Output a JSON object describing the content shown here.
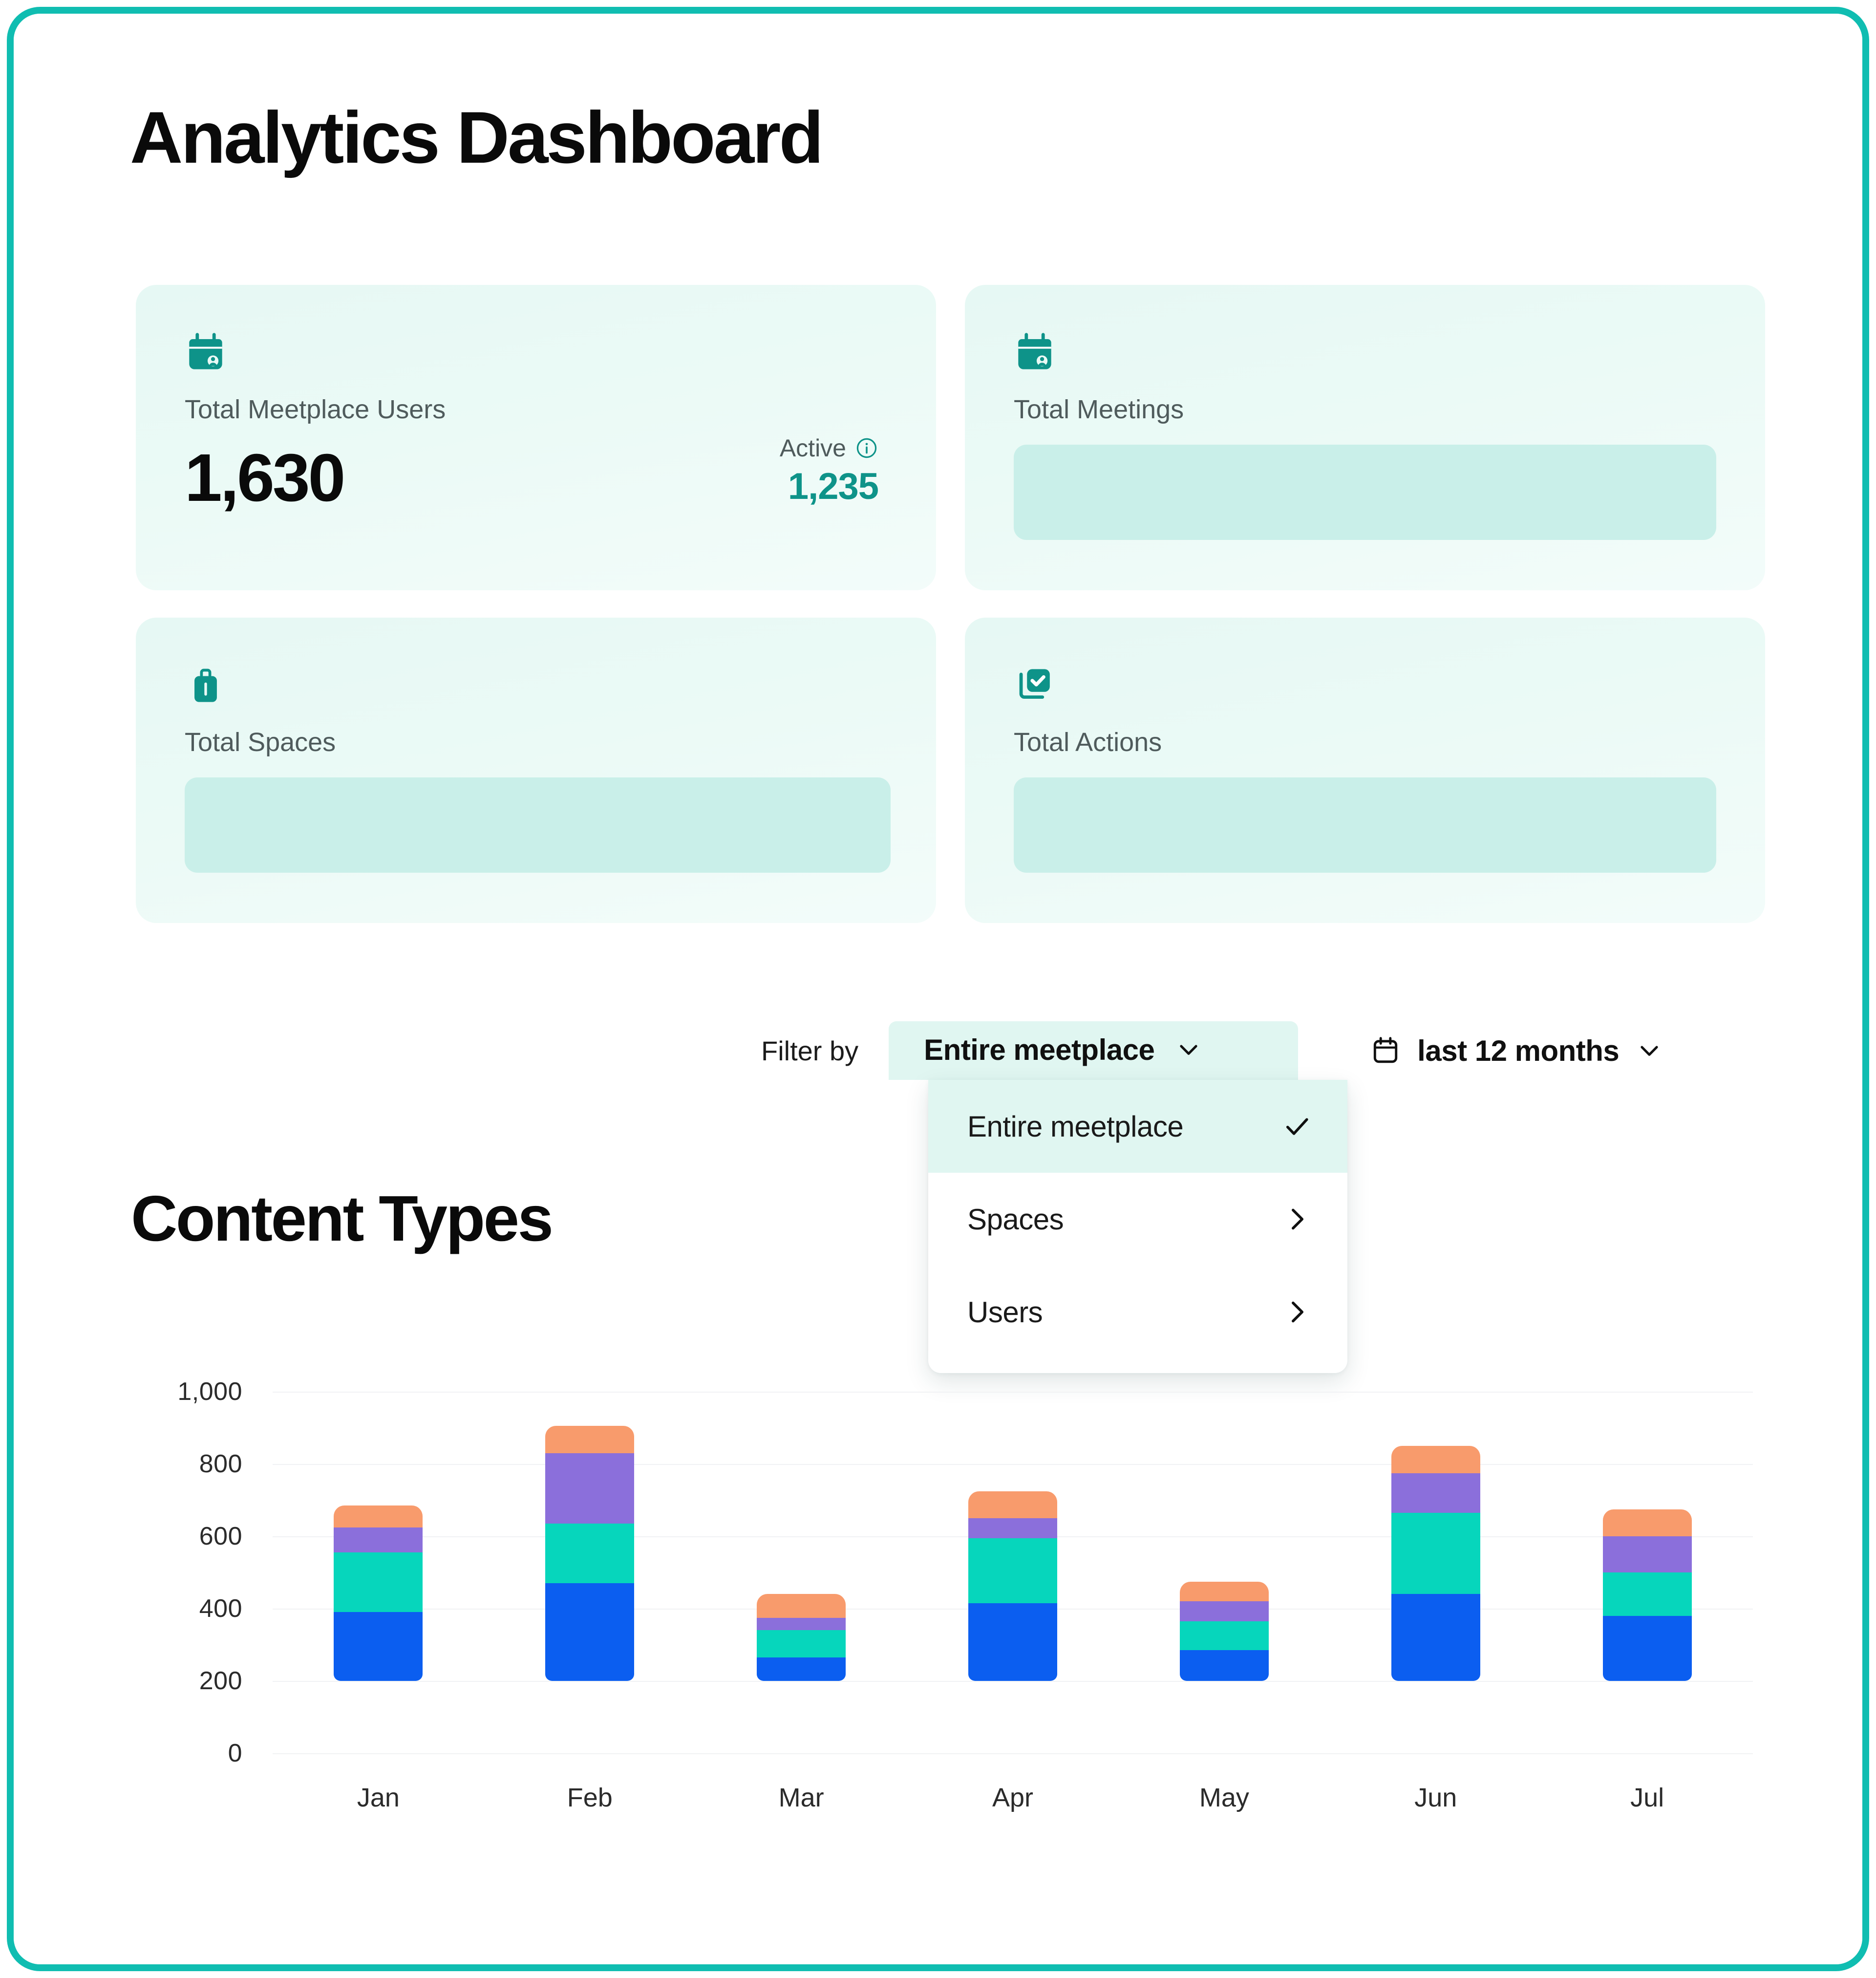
{
  "page": {
    "title": "Analytics Dashboard",
    "frame_color": "#10BDB1"
  },
  "kpis": [
    {
      "icon": "calendar-user-icon",
      "label": "Total Meetplace Users",
      "value": "1,630",
      "sub_label": "Active",
      "sub_info_icon": "info-icon",
      "sub_value": "1,235",
      "loading": false
    },
    {
      "icon": "calendar-user-icon",
      "label": "Total Meetings",
      "value": "",
      "loading": true
    },
    {
      "icon": "briefcase-icon",
      "label": "Total Spaces",
      "value": "",
      "loading": true
    },
    {
      "icon": "checked-documents-icon",
      "label": "Total Actions",
      "value": "",
      "loading": true
    }
  ],
  "filter": {
    "label": "Filter by",
    "scope": {
      "selected": "Entire meetplace",
      "chevron_icon": "chevron-down-icon",
      "open": true,
      "options": [
        {
          "label": "Entire meetplace",
          "selected": true,
          "trailing_icon": "check-icon"
        },
        {
          "label": "Spaces",
          "selected": false,
          "trailing_icon": "chevron-right-icon"
        },
        {
          "label": "Users",
          "selected": false,
          "trailing_icon": "chevron-right-icon"
        }
      ]
    },
    "range": {
      "calendar_icon": "calendar-icon",
      "selected": "last 12 months",
      "chevron_icon": "chevron-down-icon"
    }
  },
  "section": {
    "title": "Content Types"
  },
  "colors": {
    "accent_teal": "#0E9389",
    "frame_teal": "#10BDB1",
    "card_bg": "#E9F9F5",
    "skeleton": "#C9EFE9",
    "menu_selected_bg": "#E0F6F1",
    "series_blue": "#0B5EF0",
    "series_teal": "#06D6BC",
    "series_purple": "#8B6FDB",
    "series_orange": "#F89B6C"
  },
  "chart_data": {
    "type": "bar",
    "stacked": true,
    "title": "Content Types",
    "xlabel": "",
    "ylabel": "",
    "ylim": [
      0,
      1000
    ],
    "yticks": [
      0,
      200,
      400,
      600,
      800,
      1000
    ],
    "ytick_labels": [
      "0",
      "200",
      "400",
      "600",
      "800",
      "1,000"
    ],
    "grid": true,
    "legend": "none",
    "note": "Bars are clipped at the 200 gridline in the source rendering; segment values are cumulative totals read off the axis.",
    "categories": [
      "Jan",
      "Feb",
      "Mar",
      "Apr",
      "May",
      "Jun",
      "Jul"
    ],
    "series": [
      {
        "name": "series-1",
        "color": "#0B5EF0",
        "values": [
          390,
          470,
          265,
          415,
          285,
          440,
          380
        ]
      },
      {
        "name": "series-2",
        "color": "#06D6BC",
        "values": [
          165,
          165,
          75,
          180,
          80,
          225,
          120
        ]
      },
      {
        "name": "series-3",
        "color": "#8B6FDB",
        "values": [
          70,
          195,
          35,
          55,
          55,
          110,
          100
        ]
      },
      {
        "name": "series-4",
        "color": "#F89B6C",
        "values": [
          60,
          75,
          65,
          75,
          55,
          75,
          75
        ]
      }
    ],
    "totals": [
      685,
      905,
      440,
      725,
      475,
      850,
      675
    ]
  }
}
